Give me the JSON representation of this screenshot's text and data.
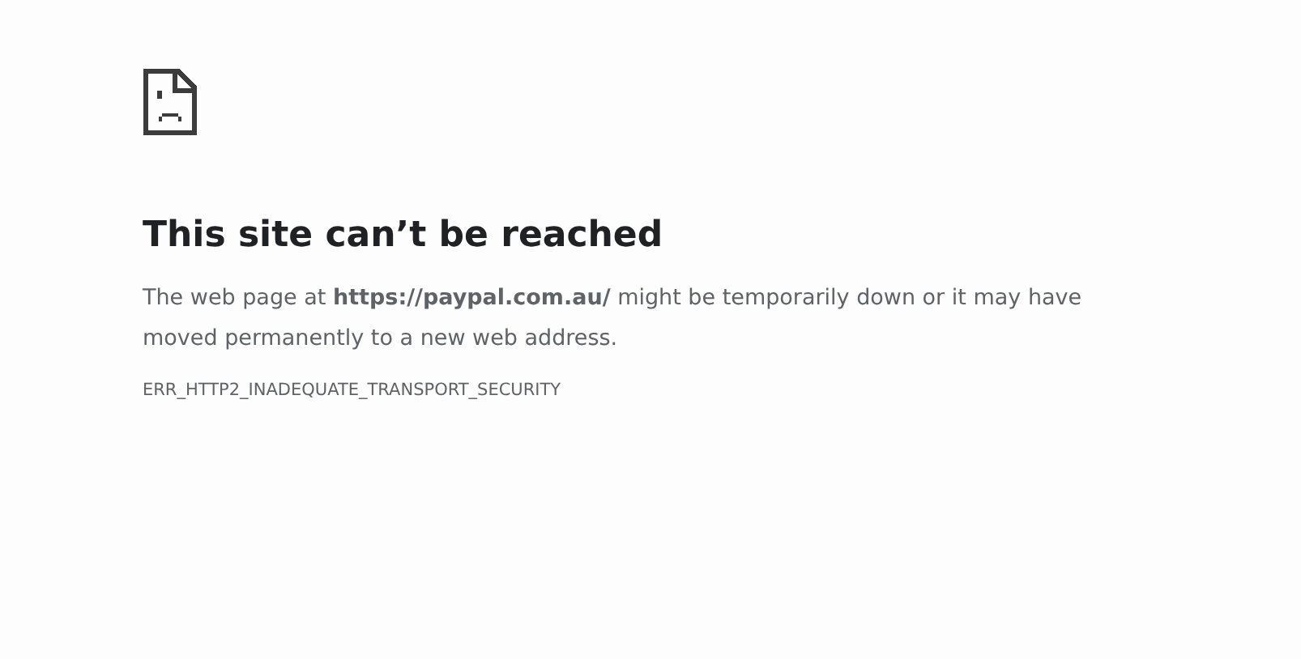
{
  "heading": "This site can’t be reached",
  "message": "The web page at **https://paypal.com.au/** might be temporarily down or it may have moved permanently to a new web address.",
  "error_code": "ERR_HTTP2_INADEQUATE_TRANSPORT_SECURITY"
}
